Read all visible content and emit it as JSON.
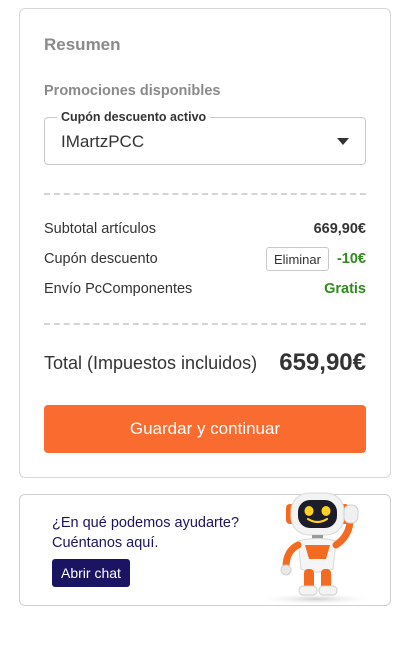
{
  "summary": {
    "title": "Resumen",
    "promotions_label": "Promociones disponibles",
    "coupon_field": {
      "legend": "Cupón descuento activo",
      "value": "IMartzPCC"
    },
    "rows": {
      "subtotal": {
        "label": "Subtotal artículos",
        "value": "669,90€"
      },
      "coupon": {
        "label": "Cupón descuento",
        "remove_label": "Eliminar",
        "value": "-10€"
      },
      "shipping": {
        "label": "Envío PcComponentes",
        "value": "Gratis"
      }
    },
    "total": {
      "label": "Total (Impuestos incluidos)",
      "value": "659,90€"
    },
    "save_button_label": "Guardar y continuar"
  },
  "help": {
    "line1": "¿En qué podemos ayudarte?",
    "line2": "Cuéntanos aquí.",
    "chat_button_label": "Abrir chat"
  },
  "colors": {
    "accent_orange": "#f96b2e",
    "navy": "#1a1463",
    "positive_green": "#2f8a1f"
  }
}
